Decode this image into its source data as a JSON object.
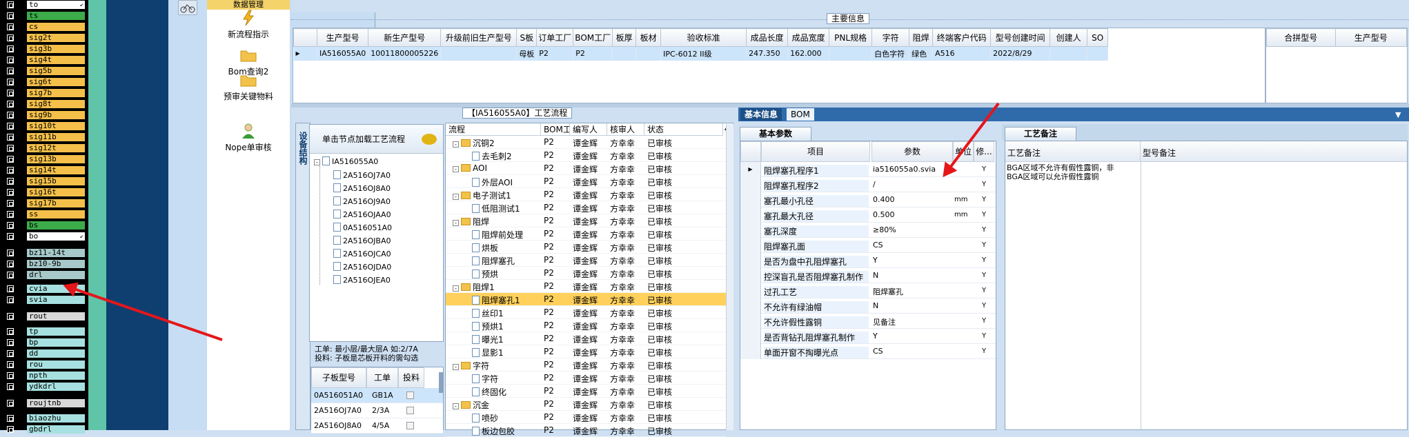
{
  "layers": {
    "items": [
      {
        "label": "to",
        "bg": "#ffffff",
        "marker": "↙"
      },
      {
        "label": "ts",
        "bg": "#3cab4a"
      },
      {
        "label": "cs",
        "bg": "#f5c04a"
      },
      {
        "label": "sig2t",
        "bg": "#f5c04a"
      },
      {
        "label": "sig3b",
        "bg": "#f5c04a"
      },
      {
        "label": "sig4t",
        "bg": "#f5c04a"
      },
      {
        "label": "sig5b",
        "bg": "#f5c04a"
      },
      {
        "label": "sig6t",
        "bg": "#f5c04a"
      },
      {
        "label": "sig7b",
        "bg": "#f5c04a"
      },
      {
        "label": "sig8t",
        "bg": "#f5c04a"
      },
      {
        "label": "sig9b",
        "bg": "#f5c04a"
      },
      {
        "label": "sig10t",
        "bg": "#f5c04a"
      },
      {
        "label": "sig11b",
        "bg": "#f5c04a"
      },
      {
        "label": "sig12t",
        "bg": "#f5c04a"
      },
      {
        "label": "sig13b",
        "bg": "#f5c04a"
      },
      {
        "label": "sig14t",
        "bg": "#f5c04a"
      },
      {
        "label": "sig15b",
        "bg": "#f5c04a"
      },
      {
        "label": "sig16t",
        "bg": "#f5c04a"
      },
      {
        "label": "sig17b",
        "bg": "#f5c04a"
      },
      {
        "label": "ss",
        "bg": "#f5c04a"
      },
      {
        "label": "bs",
        "bg": "#3cab4a"
      },
      {
        "label": "bo",
        "bg": "#ffffff",
        "marker": "↙"
      },
      {
        "label": "bz11-14t",
        "bg": "#a7c9c9"
      },
      {
        "label": "bz10-9b",
        "bg": "#a7c9c9"
      },
      {
        "label": "drl",
        "bg": "#a7c9c9"
      },
      {
        "label": "cvia",
        "bg": "#a7e0e0"
      },
      {
        "label": "svia",
        "bg": "#a7e0e0"
      },
      {
        "label": "rout",
        "bg": "#d8d8d8"
      },
      {
        "label": "tp",
        "bg": "#a7e0e0"
      },
      {
        "label": "bp",
        "bg": "#a7e0e0"
      },
      {
        "label": "dd",
        "bg": "#a7e0e0"
      },
      {
        "label": "rou",
        "bg": "#a7e0e0"
      },
      {
        "label": "npth",
        "bg": "#a7e0e0"
      },
      {
        "label": "ydkdrl",
        "bg": "#a7e0e0"
      },
      {
        "label": "roujtnb",
        "bg": "#d8d8d8"
      },
      {
        "label": "biaozhu",
        "bg": "#a7e0e0"
      },
      {
        "label": "gbdrl",
        "bg": "#a7e0e0"
      }
    ]
  },
  "nav": {
    "top_label": "数据管理",
    "items": [
      {
        "label": "新流程指示",
        "icon": "lightning-icon"
      },
      {
        "label": "Bom查询2",
        "icon": "folder-icon"
      },
      {
        "label": "预审关键物料",
        "icon": "folder-icon"
      },
      {
        "label": "Nope单审核",
        "icon": "user-icon"
      }
    ]
  },
  "main": {
    "section_title": "主要信息",
    "columns": [
      "生产型号",
      "新生产型号",
      "升级前旧生产型号",
      "S板",
      "订单工厂",
      "BOM工厂",
      "板厚",
      "板材",
      "验收标准",
      "成品长度",
      "成品宽度",
      "PNL规格",
      "字符",
      "阻焊",
      "终端客户代码",
      "型号创建时间",
      "创建人",
      "SO"
    ],
    "row": [
      "IA516055A0",
      "10011800005226",
      "",
      "母板",
      "P2",
      "P2",
      "",
      "",
      "IPC-6012 II级",
      "247.350",
      "162.000",
      "",
      "白色字符",
      "绿色",
      "A516",
      "2022/8/29",
      "",
      ""
    ],
    "right_columns": [
      "合拼型号",
      "生产型号"
    ]
  },
  "flow": {
    "title": "【IA516055A0】工艺流程",
    "side_tab": "设备结构",
    "hint": "单击节点加载工艺流程",
    "root": "IA516055A0",
    "children": [
      "2A516OJ7A0",
      "2A516OJ8A0",
      "2A516OJ9A0",
      "2A516OJAA0",
      "0A516051A0",
      "2A516OJBA0",
      "2A516OJCA0",
      "2A516OJDA0",
      "2A516OJEA0"
    ],
    "note1": "工单: 最小层/最大层A 如:2/7A",
    "note2": "投料: 子板是芯板开料的需勾选",
    "sub_columns": [
      "子板型号",
      "工单",
      "投料"
    ],
    "sub_rows": [
      [
        "0A516051A0",
        "GB1A"
      ],
      [
        "2A516OJ7A0",
        "2/3A"
      ],
      [
        "2A516OJ8A0",
        "4/5A"
      ]
    ],
    "columns": [
      "流程",
      "BOM工厂",
      "编写人",
      "核审人",
      "状态"
    ],
    "steps": [
      {
        "name": "沉铜2",
        "level": 0,
        "folder": true,
        "bom": "P2",
        "writer": "谭金辉",
        "reviewer": "方幸幸",
        "status": "已审核"
      },
      {
        "name": "去毛刺2",
        "level": 1,
        "folder": false,
        "bom": "P2",
        "writer": "谭金辉",
        "reviewer": "方幸幸",
        "status": "已审核"
      },
      {
        "name": "AOI",
        "level": 0,
        "folder": true,
        "bom": "P2",
        "writer": "谭金辉",
        "reviewer": "方幸幸",
        "status": "已审核"
      },
      {
        "name": "外层AOI",
        "level": 1,
        "folder": false,
        "bom": "P2",
        "writer": "谭金辉",
        "reviewer": "方幸幸",
        "status": "已审核"
      },
      {
        "name": "电子测试1",
        "level": 0,
        "folder": true,
        "bom": "P2",
        "writer": "谭金辉",
        "reviewer": "方幸幸",
        "status": "已审核"
      },
      {
        "name": "低阻测试1",
        "level": 1,
        "folder": false,
        "bom": "P2",
        "writer": "谭金辉",
        "reviewer": "方幸幸",
        "status": "已审核"
      },
      {
        "name": "阻焊",
        "level": 0,
        "folder": true,
        "bom": "P2",
        "writer": "谭金辉",
        "reviewer": "方幸幸",
        "status": "已审核"
      },
      {
        "name": "阻焊前处理",
        "level": 1,
        "folder": false,
        "bom": "P2",
        "writer": "谭金辉",
        "reviewer": "方幸幸",
        "status": "已审核"
      },
      {
        "name": "烘板",
        "level": 1,
        "folder": false,
        "bom": "P2",
        "writer": "谭金辉",
        "reviewer": "方幸幸",
        "status": "已审核"
      },
      {
        "name": "阻焊塞孔",
        "level": 1,
        "folder": false,
        "bom": "P2",
        "writer": "谭金辉",
        "reviewer": "方幸幸",
        "status": "已审核"
      },
      {
        "name": "预烘",
        "level": 1,
        "folder": false,
        "bom": "P2",
        "writer": "谭金辉",
        "reviewer": "方幸幸",
        "status": "已审核"
      },
      {
        "name": "阻焊1",
        "level": 0,
        "folder": true,
        "bom": "P2",
        "writer": "谭金辉",
        "reviewer": "方幸幸",
        "status": "已审核"
      },
      {
        "name": "阻焊塞孔1",
        "level": 1,
        "folder": false,
        "bom": "P2",
        "writer": "谭金辉",
        "reviewer": "方幸幸",
        "status": "已审核",
        "selected": true
      },
      {
        "name": "丝印1",
        "level": 1,
        "folder": false,
        "bom": "P2",
        "writer": "谭金辉",
        "reviewer": "方幸幸",
        "status": "已审核"
      },
      {
        "name": "预烘1",
        "level": 1,
        "folder": false,
        "bom": "P2",
        "writer": "谭金辉",
        "reviewer": "方幸幸",
        "status": "已审核"
      },
      {
        "name": "曝光1",
        "level": 1,
        "folder": false,
        "bom": "P2",
        "writer": "谭金辉",
        "reviewer": "方幸幸",
        "status": "已审核"
      },
      {
        "name": "显影1",
        "level": 1,
        "folder": false,
        "bom": "P2",
        "writer": "谭金辉",
        "reviewer": "方幸幸",
        "status": "已审核"
      },
      {
        "name": "字符",
        "level": 0,
        "folder": true,
        "bom": "P2",
        "writer": "谭金辉",
        "reviewer": "方幸幸",
        "status": "已审核"
      },
      {
        "name": "字符",
        "level": 1,
        "folder": false,
        "bom": "P2",
        "writer": "谭金辉",
        "reviewer": "方幸幸",
        "status": "已审核"
      },
      {
        "name": "终固化",
        "level": 1,
        "folder": false,
        "bom": "P2",
        "writer": "谭金辉",
        "reviewer": "方幸幸",
        "status": "已审核"
      },
      {
        "name": "沉金",
        "level": 0,
        "folder": true,
        "bom": "P2",
        "writer": "谭金辉",
        "reviewer": "方幸幸",
        "status": "已审核"
      },
      {
        "name": "喷砂",
        "level": 1,
        "folder": false,
        "bom": "P2",
        "writer": "谭金辉",
        "reviewer": "方幸幸",
        "status": "已审核"
      },
      {
        "name": "板边包胶",
        "level": 1,
        "folder": false,
        "bom": "P2",
        "writer": "谭金辉",
        "reviewer": "方幸幸",
        "status": "已审核"
      }
    ]
  },
  "info": {
    "tabs": [
      "基本信息",
      "BOM"
    ],
    "subtab": "基本参数",
    "columns": [
      "项目",
      "参数",
      "单位",
      "修..."
    ],
    "rows": [
      {
        "item": "阻焊塞孔程序1",
        "param": "ia516055a0.svia",
        "unit": "",
        "mod": "Y",
        "current": true
      },
      {
        "item": "阻焊塞孔程序2",
        "param": "/",
        "unit": "",
        "mod": "Y"
      },
      {
        "item": "塞孔最小孔径",
        "param": "0.400",
        "unit": "mm",
        "mod": "Y"
      },
      {
        "item": "塞孔最大孔径",
        "param": "0.500",
        "unit": "mm",
        "mod": "Y"
      },
      {
        "item": "塞孔深度",
        "param": "≥80%",
        "unit": "",
        "mod": "Y"
      },
      {
        "item": "阻焊塞孔面",
        "param": "CS",
        "unit": "",
        "mod": "Y"
      },
      {
        "item": "是否为盘中孔阻焊塞孔",
        "param": "Y",
        "unit": "",
        "mod": "Y"
      },
      {
        "item": "控深盲孔是否阻焊塞孔制作",
        "param": "N",
        "unit": "",
        "mod": "Y"
      },
      {
        "item": "过孔工艺",
        "param": "阻焊塞孔",
        "unit": "",
        "mod": "Y"
      },
      {
        "item": "不允许有绿油帽",
        "param": "N",
        "unit": "",
        "mod": "Y"
      },
      {
        "item": "不允许假性露铜",
        "param": "见备注",
        "unit": "",
        "mod": "Y"
      },
      {
        "item": "是否背钻孔阻焊塞孔制作",
        "param": "Y",
        "unit": "",
        "mod": "Y"
      },
      {
        "item": "单面开窗不掏曝光点",
        "param": "CS",
        "unit": "",
        "mod": "Y"
      }
    ]
  },
  "notes": {
    "tab": "工艺备注",
    "columns": [
      "工艺备注",
      "型号备注"
    ],
    "text1": "BGA区域不允许有假性露铜，非",
    "text2": "BGA区域可以允许假性露铜"
  },
  "colors": {
    "accent": "#0e3d6d",
    "highlight": "#ffd15c",
    "selection": "#cde5fb",
    "annotation_arrow": "#e5161a"
  }
}
